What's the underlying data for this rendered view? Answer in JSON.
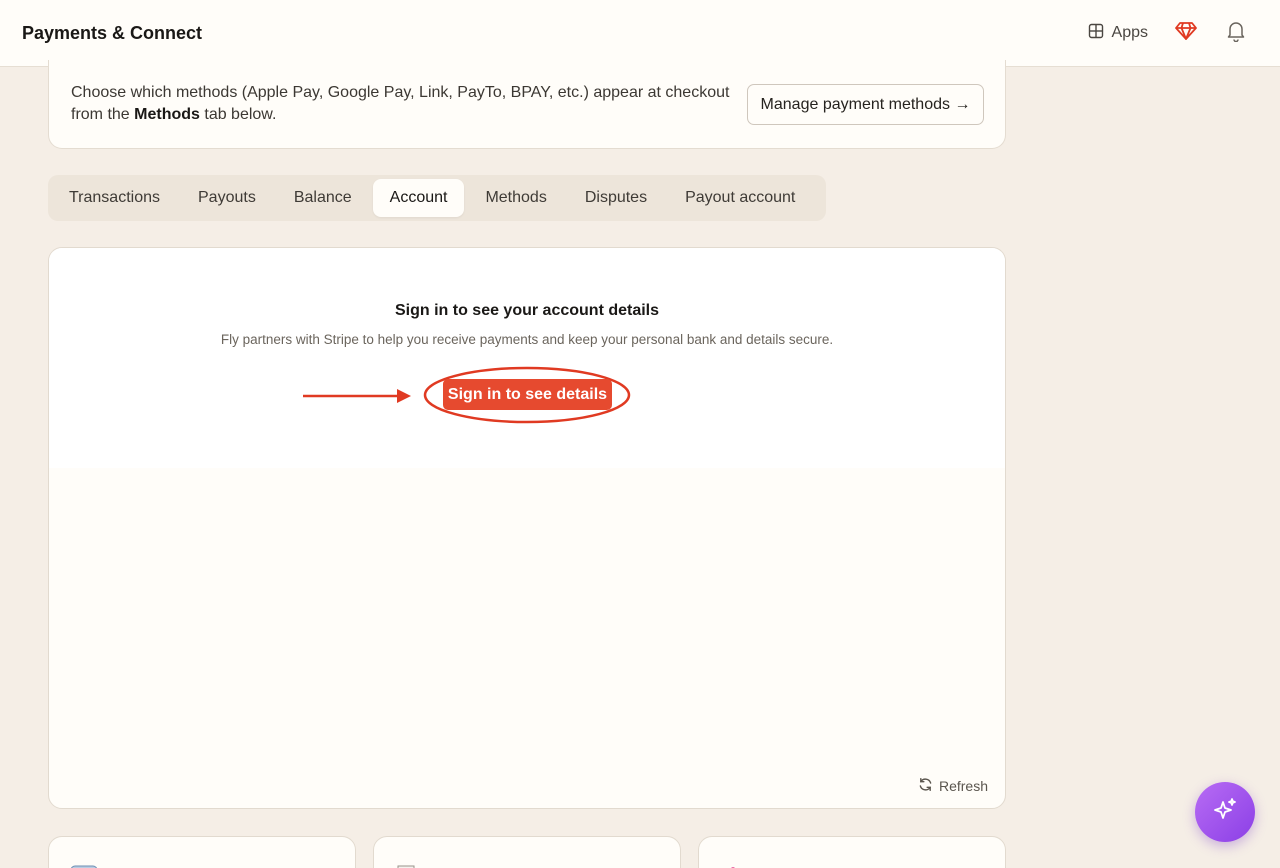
{
  "header": {
    "title": "Payments & Connect",
    "apps_label": "Apps",
    "icons": [
      "apps-grid-icon",
      "gem-icon",
      "bell-icon"
    ]
  },
  "info": {
    "text_before": "Choose which methods (Apple Pay, Google Pay, Link, PayTo, BPAY, etc.) appear at checkout from the ",
    "text_bold": "Methods",
    "text_after": " tab below.",
    "manage_button": "Manage payment methods →"
  },
  "tabs": [
    {
      "label": "Transactions",
      "active": false
    },
    {
      "label": "Payouts",
      "active": false
    },
    {
      "label": "Balance",
      "active": false
    },
    {
      "label": "Account",
      "active": true
    },
    {
      "label": "Methods",
      "active": false
    },
    {
      "label": "Disputes",
      "active": false
    },
    {
      "label": "Payout account",
      "active": false
    }
  ],
  "account_panel": {
    "heading": "Sign in to see your account details",
    "subtext": "Fly partners with Stripe to help you receive payments and keep your personal bank and details secure.",
    "signin_button": "Sign in to see details",
    "refresh_label": "Refresh"
  },
  "colors": {
    "page_bg": "#f5eee6",
    "accent_red": "#e64a2f",
    "annotation_red": "#e03a22",
    "assistant_purple": "#9b4ef0"
  }
}
